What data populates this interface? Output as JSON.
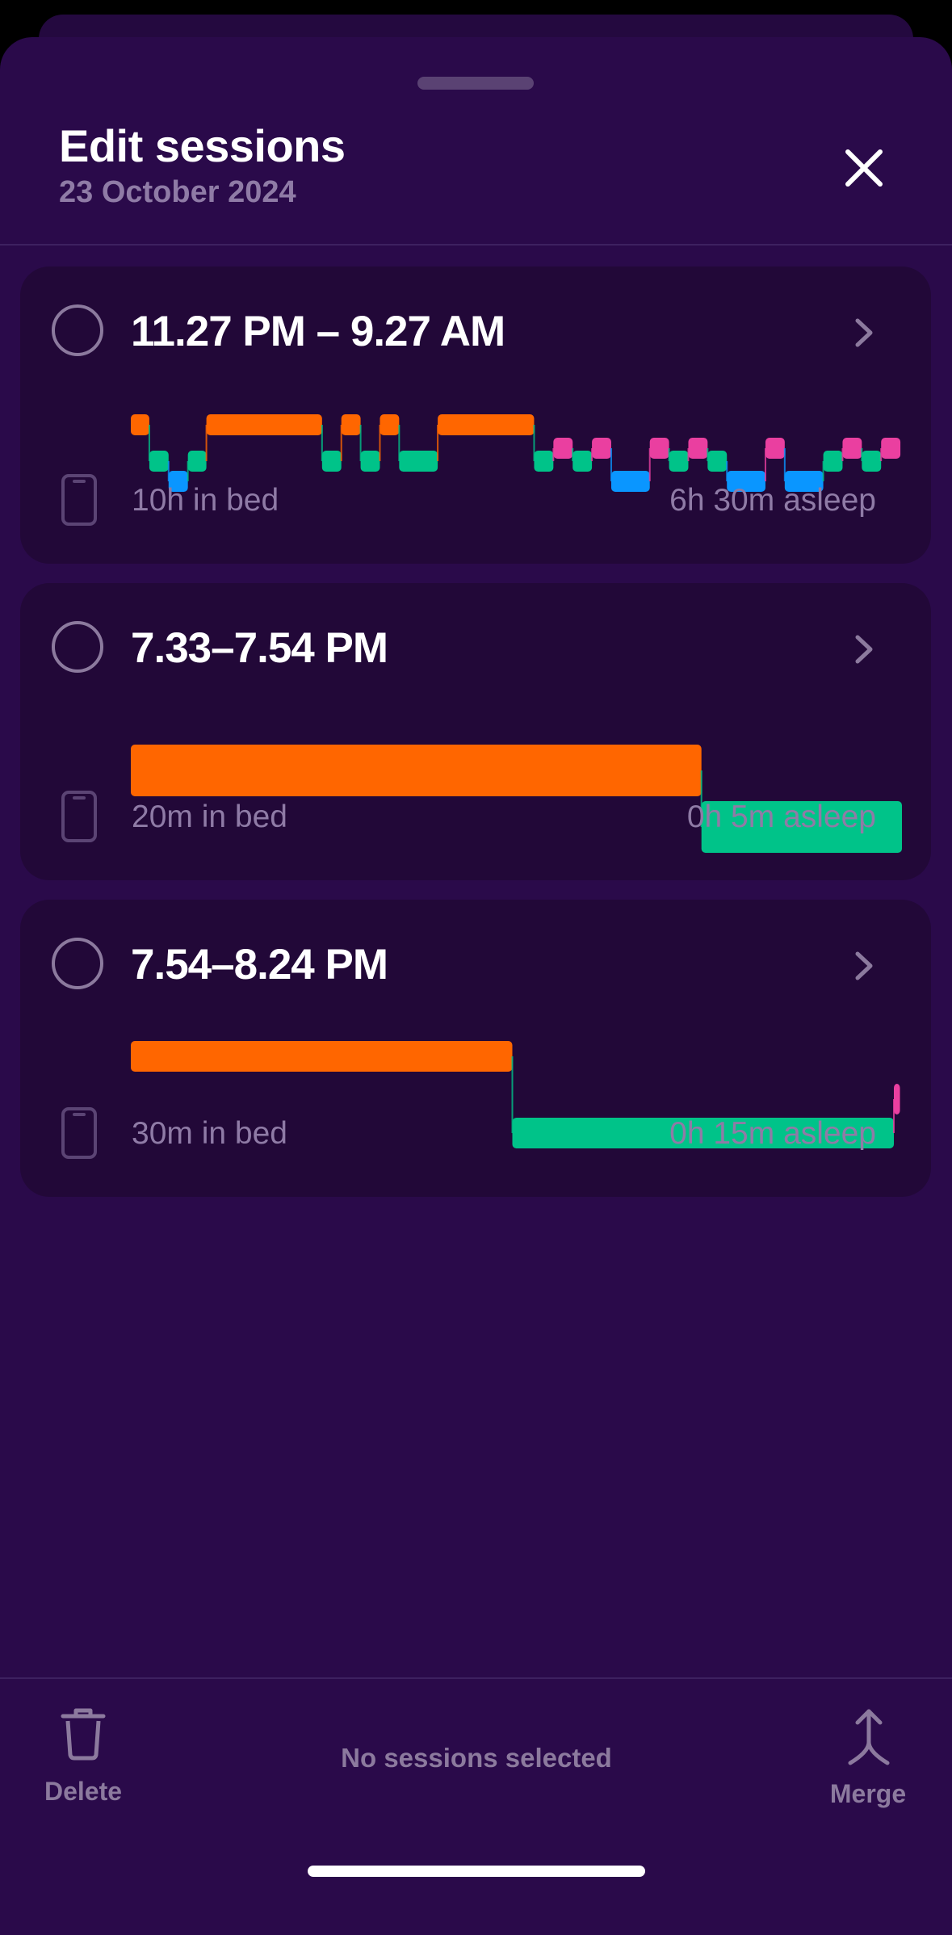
{
  "header": {
    "title": "Edit sessions",
    "date": "23 October 2024"
  },
  "colors": {
    "awake": "#ff6600",
    "rem": "#ea3fa0",
    "light": "#00c389",
    "deep": "#0a96ff",
    "background": "#2a0a4a",
    "card": "#220838",
    "muted_text": "#8f7ba6"
  },
  "stage_legend_note": "awake / rem / light / deep",
  "sessions": [
    {
      "time_range": "11.27 PM – 9.27 AM",
      "in_bed": "10h in bed",
      "asleep": "6h 30m asleep",
      "hypnogram": [
        [
          "awake",
          0.024
        ],
        [
          "light",
          0.025
        ],
        [
          "deep",
          0.025
        ],
        [
          "light",
          0.024
        ],
        [
          "awake",
          0.15
        ],
        [
          "light",
          0.025
        ],
        [
          "awake",
          0.025
        ],
        [
          "light",
          0.025
        ],
        [
          "awake",
          0.025
        ],
        [
          "light",
          0.05
        ],
        [
          "awake",
          0.125
        ],
        [
          "light",
          0.025
        ],
        [
          "rem",
          0.025
        ],
        [
          "light",
          0.025
        ],
        [
          "rem",
          0.025
        ],
        [
          "deep",
          0.05
        ],
        [
          "rem",
          0.025
        ],
        [
          "light",
          0.025
        ],
        [
          "rem",
          0.025
        ],
        [
          "light",
          0.025
        ],
        [
          "deep",
          0.05
        ],
        [
          "rem",
          0.025
        ],
        [
          "deep",
          0.05
        ],
        [
          "light",
          0.025
        ],
        [
          "rem",
          0.025
        ],
        [
          "light",
          0.025
        ],
        [
          "rem",
          0.025
        ]
      ]
    },
    {
      "time_range": "7.33–7.54 PM",
      "in_bed": "20m in bed",
      "asleep": "0h 5m asleep",
      "hypnogram": [
        [
          "awake",
          0.74
        ],
        [
          "light",
          0.26
        ]
      ]
    },
    {
      "time_range": "7.54–8.24 PM",
      "in_bed": "30m in bed",
      "asleep": "0h 15m asleep",
      "hypnogram": [
        [
          "awake",
          0.5
        ],
        [
          "light",
          0.5
        ],
        [
          "rem",
          0.008
        ]
      ]
    }
  ],
  "footer": {
    "delete_label": "Delete",
    "status": "No sessions selected",
    "merge_label": "Merge"
  }
}
